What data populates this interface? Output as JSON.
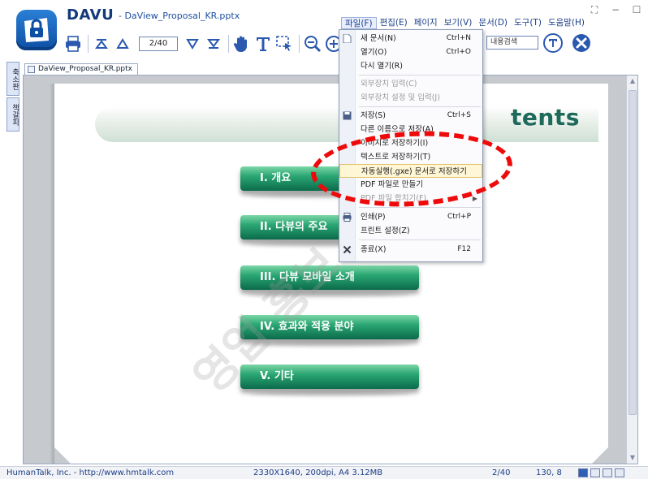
{
  "app": {
    "brand": "DAVU",
    "doc_title": "- DaView_Proposal_KR.pptx",
    "accent": "#1f4fa0"
  },
  "window_controls": {
    "fullscreen": "⛶",
    "minimize": "−",
    "maximize": "☐"
  },
  "menubar": [
    {
      "label": "파일(F)",
      "active": true
    },
    {
      "label": "편집(E)"
    },
    {
      "label": "페이지"
    },
    {
      "label": "보기(V)"
    },
    {
      "label": "문서(D)"
    },
    {
      "label": "도구(T)"
    },
    {
      "label": "도움말(H)"
    }
  ],
  "toolbar": {
    "page_value": "2/40",
    "search_placeholder": "내용검색",
    "icons": [
      "print-icon",
      "first-page-icon",
      "prev-page-icon",
      "next-page-icon",
      "last-page-icon",
      "hand-tool-icon",
      "text-tool-icon",
      "select-area-icon",
      "zoom-out-icon",
      "zoom-in-icon",
      "search-icon",
      "close-doc-icon"
    ]
  },
  "sidebar": {
    "tabs": [
      "축소판",
      "책갈피"
    ]
  },
  "document_tab": {
    "label": "DaView_Proposal_KR.pptx"
  },
  "slide": {
    "title": "tents",
    "toc": [
      "I. 개요",
      "II. 다뷰의 주요",
      "III. 다뷰 모바일 소개",
      "IV. 효과와 적용 분야",
      "V. 기타"
    ],
    "watermark": "영업 홍보"
  },
  "file_menu": {
    "items": [
      {
        "label": "새 문서(N)",
        "shortcut": "Ctrl+N",
        "icon": "new-document-icon"
      },
      {
        "label": "열기(O)",
        "shortcut": "Ctrl+O"
      },
      {
        "label": "다시 열기(R)"
      },
      {
        "label": "외부장치 입력(C)",
        "disabled": true
      },
      {
        "label": "외부장치 설정 및 입력(J)",
        "disabled": true
      },
      {
        "label": "저장(S)",
        "shortcut": "Ctrl+S",
        "icon": "save-icon"
      },
      {
        "label": "다른 이름으로 저장(A)"
      },
      {
        "label": "이미지로 저장하기(I)"
      },
      {
        "label": "텍스트로 저장하기(T)"
      },
      {
        "label": "자동실행(.gxe) 문서로 저장하기",
        "highlighted": true
      },
      {
        "label": "PDF 파일로 만들기"
      },
      {
        "label": "PDF 파일 합치기(F)",
        "disabled": true,
        "submenu": true
      },
      {
        "label": "인쇄(P)",
        "shortcut": "Ctrl+P",
        "icon": "print-icon"
      },
      {
        "label": "프린트 설정(Z)"
      },
      {
        "label": "종료(X)",
        "shortcut": "F12",
        "icon": "exit-icon"
      }
    ]
  },
  "statusbar": {
    "company": "HumanTalk, Inc. - http://www.hmtalk.com",
    "page_info": "2330X1640, 200dpi, A4 3.12MB",
    "page": "2/40",
    "zoom": "130, 8"
  }
}
